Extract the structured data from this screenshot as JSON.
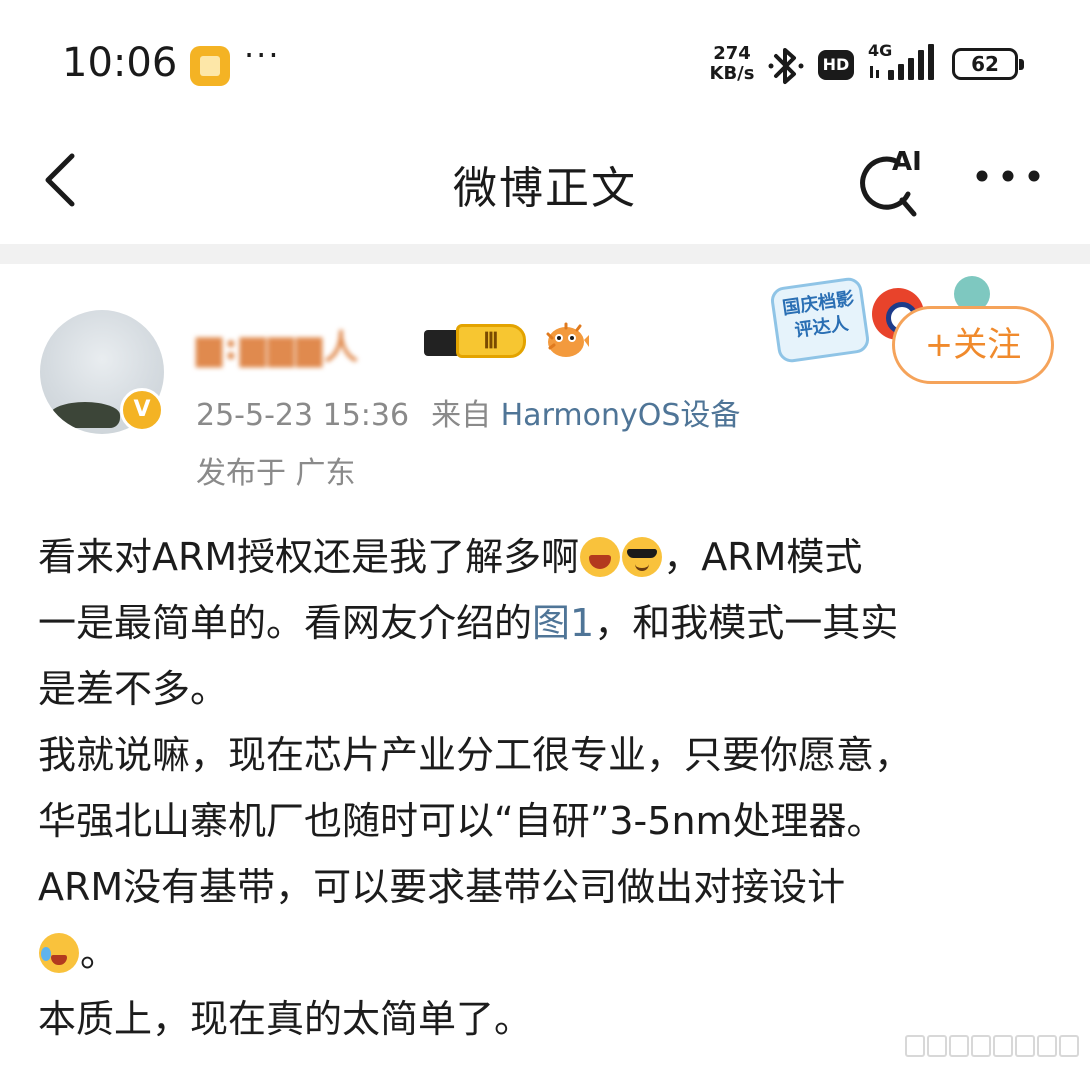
{
  "status_bar": {
    "time": "10:06",
    "more": "···",
    "net_speed_value": "274",
    "net_speed_unit": "KB/s",
    "hd_label": "HD",
    "network_label": "4G",
    "battery": "62"
  },
  "nav": {
    "title": "微博正文",
    "ai_label": "AI"
  },
  "post": {
    "username": "▆:▆▆▆人",
    "level": "Ⅲ",
    "verified_mark": "V",
    "timestamp": "25-5-23 15:36",
    "source_prefix": "来自",
    "source": "HarmonyOS设备",
    "location": "发布于 广东",
    "follow_label": "+关注",
    "event_badge_text": "国庆档影评达人",
    "body": {
      "l1_a": "看来对ARM授权还是我了解多啊",
      "l1_b": "，ARM模式",
      "l2_a": "一是最简单的。看网友介绍的",
      "l2_link": "图1",
      "l2_b": "，和我模式一其实",
      "l3": "是差不多。",
      "l4": "我就说嘛，现在芯片产业分工很专业，只要你愿意，",
      "l5": "华强北山寨机厂也随时可以“自研”3-5nm处理器。",
      "l6": "ARM没有基带，可以要求基带公司做出对接设计",
      "l7_b": "。",
      "l8": "本质上，现在真的太简单了。"
    }
  },
  "colors": {
    "link": "#4f7597",
    "follow": "#f08a2c",
    "verified": "#f4b324",
    "meta": "#8a8a8a"
  },
  "icons": [
    "back-chevron-icon",
    "ai-search-icon",
    "more-dots-icon",
    "bluetooth-icon",
    "signal-icon",
    "battery-icon",
    "laugh-emoji-icon",
    "cool-emoji-icon",
    "cry-laugh-emoji-icon",
    "puffer-fish-icon",
    "weibo-eye-icon",
    "film-reel-icon"
  ]
}
